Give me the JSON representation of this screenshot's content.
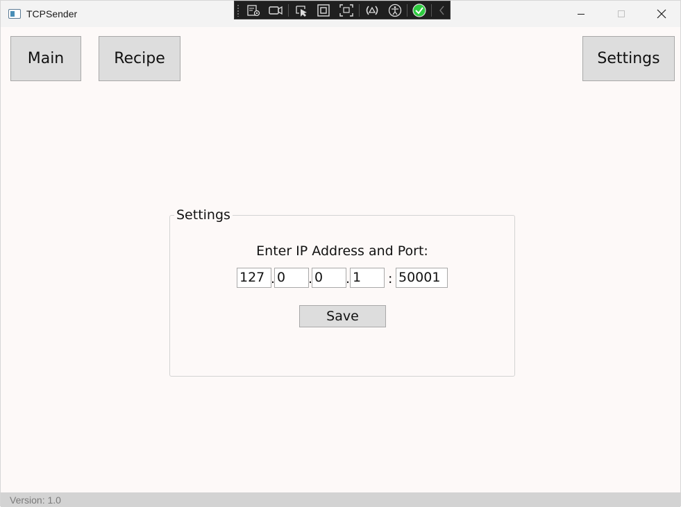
{
  "window": {
    "title": "TCPSender",
    "app_icon": "app-window-icon"
  },
  "caption_buttons": {
    "minimize": "minimize-icon",
    "maximize": "maximize-icon",
    "close": "close-icon"
  },
  "debug_toolbar": {
    "icons": [
      "live-visual-tree-icon",
      "record-icon",
      "select-element-icon",
      "display-layout-adorners-icon",
      "track-focus-icon",
      "binding-failures-icon",
      "accessibility-icon",
      "checkmark-icon",
      "collapse-chevron-icon"
    ],
    "check_color": "#2ecc40"
  },
  "nav": {
    "main_label": "Main",
    "recipe_label": "Recipe",
    "settings_label": "Settings"
  },
  "settings_group": {
    "header": "Settings",
    "prompt": "Enter IP Address and Port:",
    "ip": [
      "127",
      "0",
      "0",
      "1"
    ],
    "dot": ".",
    "colon": ":",
    "port": "50001",
    "save_label": "Save"
  },
  "status": {
    "version": "Version: 1.0"
  }
}
